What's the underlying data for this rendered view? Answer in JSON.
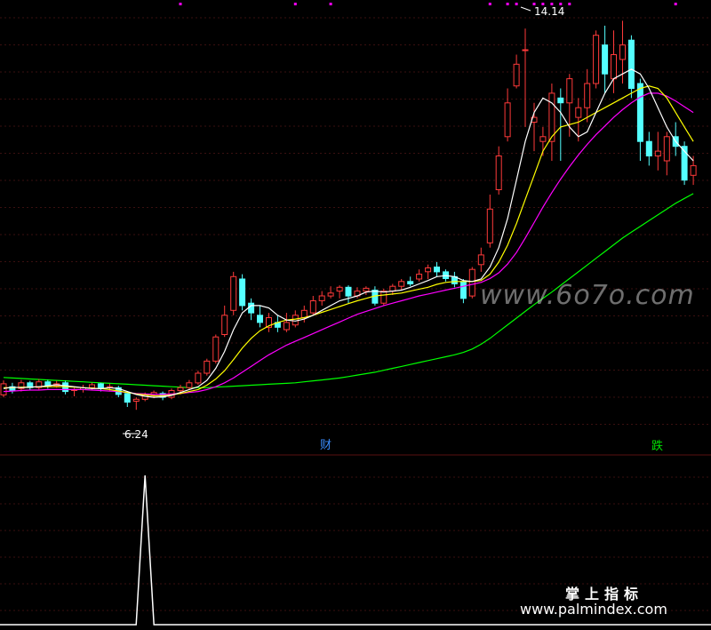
{
  "chart_data": [
    {
      "type": "candlestick",
      "panel": "main",
      "price_range": [
        5.6,
        14.4
      ],
      "high_marker": "14.14",
      "low_marker": "6.24",
      "colors": {
        "up": "#ff3a3a",
        "down": "#54ffff",
        "ma5": "#ffffff",
        "ma10": "#ffff00",
        "ma20": "#ff00ff",
        "ma60": "#00ff00",
        "grid": "#3a1010",
        "background": "#000000",
        "signal_cai": "#3a8dff",
        "signal_die": "#00e000",
        "top_dots": "#ff00ff"
      },
      "candles": [
        [
          6.55,
          6.78,
          6.5,
          6.85
        ],
        [
          6.72,
          6.64,
          6.58,
          6.8
        ],
        [
          6.68,
          6.8,
          6.62,
          6.86
        ],
        [
          6.8,
          6.7,
          6.64,
          6.84
        ],
        [
          6.7,
          6.82,
          6.66,
          6.88
        ],
        [
          6.82,
          6.74,
          6.68,
          6.86
        ],
        [
          6.74,
          6.78,
          6.7,
          6.84
        ],
        [
          6.8,
          6.62,
          6.56,
          6.84
        ],
        [
          6.64,
          6.66,
          6.52,
          6.7
        ],
        [
          6.66,
          6.7,
          6.6,
          6.76
        ],
        [
          6.7,
          6.76,
          6.66,
          6.8
        ],
        [
          6.78,
          6.68,
          6.62,
          6.8
        ],
        [
          6.7,
          6.72,
          6.64,
          6.78
        ],
        [
          6.7,
          6.56,
          6.5,
          6.74
        ],
        [
          6.58,
          6.4,
          6.3,
          6.6
        ],
        [
          6.42,
          6.46,
          6.24,
          6.5
        ],
        [
          6.46,
          6.56,
          6.42,
          6.6
        ],
        [
          6.56,
          6.6,
          6.48,
          6.64
        ],
        [
          6.58,
          6.5,
          6.44,
          6.62
        ],
        [
          6.5,
          6.64,
          6.46,
          6.68
        ],
        [
          6.64,
          6.7,
          6.56,
          6.76
        ],
        [
          6.7,
          6.8,
          6.66,
          6.86
        ],
        [
          6.8,
          7.0,
          6.76,
          7.05
        ],
        [
          7.0,
          7.25,
          6.95,
          7.3
        ],
        [
          7.25,
          7.75,
          7.2,
          7.8
        ],
        [
          7.8,
          8.2,
          7.75,
          8.4
        ],
        [
          8.3,
          9.0,
          8.2,
          9.1
        ],
        [
          8.95,
          8.4,
          8.3,
          9.05
        ],
        [
          8.45,
          8.25,
          8.1,
          8.55
        ],
        [
          8.2,
          8.05,
          7.95,
          8.4
        ],
        [
          7.95,
          8.15,
          7.85,
          8.25
        ],
        [
          8.05,
          7.95,
          7.85,
          8.2
        ],
        [
          7.9,
          8.05,
          7.85,
          8.25
        ],
        [
          8.0,
          8.2,
          7.95,
          8.3
        ],
        [
          8.15,
          8.3,
          8.05,
          8.4
        ],
        [
          8.25,
          8.5,
          8.2,
          8.6
        ],
        [
          8.5,
          8.6,
          8.4,
          8.7
        ],
        [
          8.6,
          8.66,
          8.55,
          8.8
        ],
        [
          8.7,
          8.78,
          8.55,
          8.82
        ],
        [
          8.78,
          8.6,
          8.45,
          8.82
        ],
        [
          8.6,
          8.7,
          8.55,
          8.78
        ],
        [
          8.7,
          8.76,
          8.62,
          8.8
        ],
        [
          8.72,
          8.45,
          8.4,
          8.8
        ],
        [
          8.45,
          8.7,
          8.4,
          8.75
        ],
        [
          8.7,
          8.8,
          8.62,
          8.85
        ],
        [
          8.8,
          8.9,
          8.72,
          8.95
        ],
        [
          8.9,
          8.85,
          8.8,
          9.0
        ],
        [
          8.95,
          9.05,
          8.9,
          9.15
        ],
        [
          9.1,
          9.18,
          8.95,
          9.25
        ],
        [
          9.2,
          9.1,
          9.0,
          9.3
        ],
        [
          9.1,
          8.96,
          8.9,
          9.15
        ],
        [
          9.0,
          8.85,
          8.78,
          9.1
        ],
        [
          8.9,
          8.55,
          8.45,
          8.95
        ],
        [
          8.6,
          9.15,
          8.55,
          9.2
        ],
        [
          9.25,
          9.45,
          9.1,
          9.6
        ],
        [
          9.7,
          10.4,
          9.6,
          10.7
        ],
        [
          10.8,
          11.5,
          10.7,
          11.7
        ],
        [
          11.9,
          12.6,
          11.8,
          12.9
        ],
        [
          12.95,
          13.4,
          12.9,
          13.6
        ],
        [
          13.7,
          13.7,
          12.1,
          14.14
        ],
        [
          12.2,
          12.3,
          11.6,
          12.6
        ],
        [
          11.8,
          11.9,
          11.5,
          12.1
        ],
        [
          11.8,
          12.8,
          11.4,
          13.0
        ],
        [
          12.7,
          12.6,
          11.4,
          12.9
        ],
        [
          12.6,
          13.1,
          11.9,
          13.2
        ],
        [
          12.3,
          12.5,
          11.8,
          12.7
        ],
        [
          12.5,
          13.0,
          12.2,
          13.3
        ],
        [
          13.0,
          14.0,
          12.9,
          14.1
        ],
        [
          13.8,
          13.2,
          12.8,
          14.2
        ],
        [
          13.1,
          13.6,
          12.8,
          14.1
        ],
        [
          13.5,
          13.8,
          13.0,
          14.3
        ],
        [
          13.9,
          12.9,
          12.7,
          14.0
        ],
        [
          13.0,
          11.8,
          11.4,
          13.1
        ],
        [
          11.8,
          11.5,
          11.3,
          12.0
        ],
        [
          11.5,
          11.6,
          11.2,
          12.0
        ],
        [
          11.4,
          11.9,
          11.1,
          12.0
        ],
        [
          11.9,
          11.7,
          11.5,
          12.2
        ],
        [
          11.7,
          11.0,
          10.9,
          11.8
        ],
        [
          11.1,
          11.3,
          10.9,
          11.5
        ]
      ],
      "ma_lines": [
        {
          "name": "MA5",
          "values": [
            6.68,
            6.71,
            6.7,
            6.71,
            6.72,
            6.74,
            6.76,
            6.74,
            6.72,
            6.7,
            6.68,
            6.68,
            6.7,
            6.68,
            6.62,
            6.56,
            6.52,
            6.5,
            6.51,
            6.54,
            6.6,
            6.66,
            6.72,
            6.85,
            7.1,
            7.45,
            7.9,
            8.25,
            8.4,
            8.4,
            8.35,
            8.2,
            8.1,
            8.08,
            8.12,
            8.2,
            8.3,
            8.4,
            8.5,
            8.55,
            8.6,
            8.68,
            8.7,
            8.68,
            8.7,
            8.72,
            8.78,
            8.85,
            8.92,
            9.0,
            9.02,
            9.0,
            8.92,
            8.9,
            8.95,
            9.2,
            9.6,
            10.2,
            11.0,
            11.8,
            12.4,
            12.7,
            12.6,
            12.4,
            12.1,
            11.9,
            12.0,
            12.4,
            12.8,
            13.1,
            13.2,
            13.3,
            13.2,
            12.9,
            12.5,
            12.1,
            11.8,
            11.6,
            11.4
          ]
        },
        {
          "name": "MA10",
          "values": [
            6.7,
            6.7,
            6.71,
            6.71,
            6.72,
            6.72,
            6.72,
            6.72,
            6.71,
            6.7,
            6.69,
            6.68,
            6.66,
            6.63,
            6.6,
            6.57,
            6.55,
            6.53,
            6.53,
            6.55,
            6.58,
            6.62,
            6.66,
            6.75,
            6.88,
            7.05,
            7.28,
            7.52,
            7.72,
            7.88,
            7.98,
            8.05,
            8.1,
            8.12,
            8.15,
            8.2,
            8.26,
            8.32,
            8.38,
            8.44,
            8.5,
            8.55,
            8.6,
            8.62,
            8.64,
            8.66,
            8.7,
            8.74,
            8.78,
            8.84,
            8.88,
            8.9,
            8.9,
            8.9,
            8.92,
            9.05,
            9.3,
            9.65,
            10.1,
            10.6,
            11.1,
            11.6,
            11.9,
            12.1,
            12.15,
            12.2,
            12.3,
            12.4,
            12.5,
            12.6,
            12.7,
            12.8,
            12.9,
            12.95,
            12.9,
            12.7,
            12.4,
            12.1,
            11.8
          ]
        },
        {
          "name": "MA20",
          "values": [
            6.62,
            6.63,
            6.64,
            6.65,
            6.65,
            6.66,
            6.66,
            6.66,
            6.66,
            6.66,
            6.65,
            6.64,
            6.63,
            6.62,
            6.6,
            6.58,
            6.57,
            6.56,
            6.56,
            6.57,
            6.58,
            6.6,
            6.62,
            6.66,
            6.72,
            6.8,
            6.9,
            7.02,
            7.14,
            7.26,
            7.38,
            7.48,
            7.58,
            7.66,
            7.74,
            7.82,
            7.9,
            7.98,
            8.06,
            8.14,
            8.22,
            8.28,
            8.34,
            8.4,
            8.45,
            8.5,
            8.55,
            8.6,
            8.64,
            8.68,
            8.72,
            8.76,
            8.8,
            8.84,
            8.88,
            8.96,
            9.08,
            9.26,
            9.5,
            9.8,
            10.12,
            10.44,
            10.74,
            11.02,
            11.28,
            11.52,
            11.74,
            11.94,
            12.12,
            12.3,
            12.46,
            12.6,
            12.72,
            12.8,
            12.8,
            12.74,
            12.64,
            12.52,
            12.4
          ]
        },
        {
          "name": "MA60",
          "values": [
            6.91,
            6.9,
            6.89,
            6.88,
            6.87,
            6.86,
            6.85,
            6.84,
            6.83,
            6.82,
            6.81,
            6.8,
            6.79,
            6.78,
            6.77,
            6.76,
            6.75,
            6.74,
            6.73,
            6.72,
            6.71,
            6.7,
            6.7,
            6.7,
            6.71,
            6.72,
            6.73,
            6.74,
            6.75,
            6.76,
            6.77,
            6.78,
            6.79,
            6.8,
            6.82,
            6.84,
            6.86,
            6.88,
            6.9,
            6.93,
            6.96,
            6.99,
            7.02,
            7.06,
            7.1,
            7.14,
            7.18,
            7.22,
            7.26,
            7.3,
            7.34,
            7.38,
            7.43,
            7.5,
            7.6,
            7.72,
            7.86,
            8.0,
            8.14,
            8.28,
            8.42,
            8.55,
            8.68,
            8.82,
            8.96,
            9.1,
            9.24,
            9.38,
            9.52,
            9.66,
            9.8,
            9.92,
            10.04,
            10.16,
            10.28,
            10.4,
            10.52,
            10.62,
            10.72
          ]
        }
      ],
      "annotations": [
        {
          "text": "财",
          "index": 37
        },
        {
          "text": "跌",
          "index": 75
        }
      ],
      "top_dot_indices": [
        20,
        33,
        37,
        55,
        57,
        58,
        60,
        61,
        62,
        63,
        64,
        76
      ]
    },
    {
      "type": "line",
      "panel": "indicator",
      "ylim": [
        0,
        1
      ],
      "spike_index": 16,
      "values_description_count": 79
    }
  ],
  "watermarks": {
    "site": "www.6o7o.com",
    "brand_cn": "掌上指标",
    "brand_url": "www.palmindex.com"
  }
}
